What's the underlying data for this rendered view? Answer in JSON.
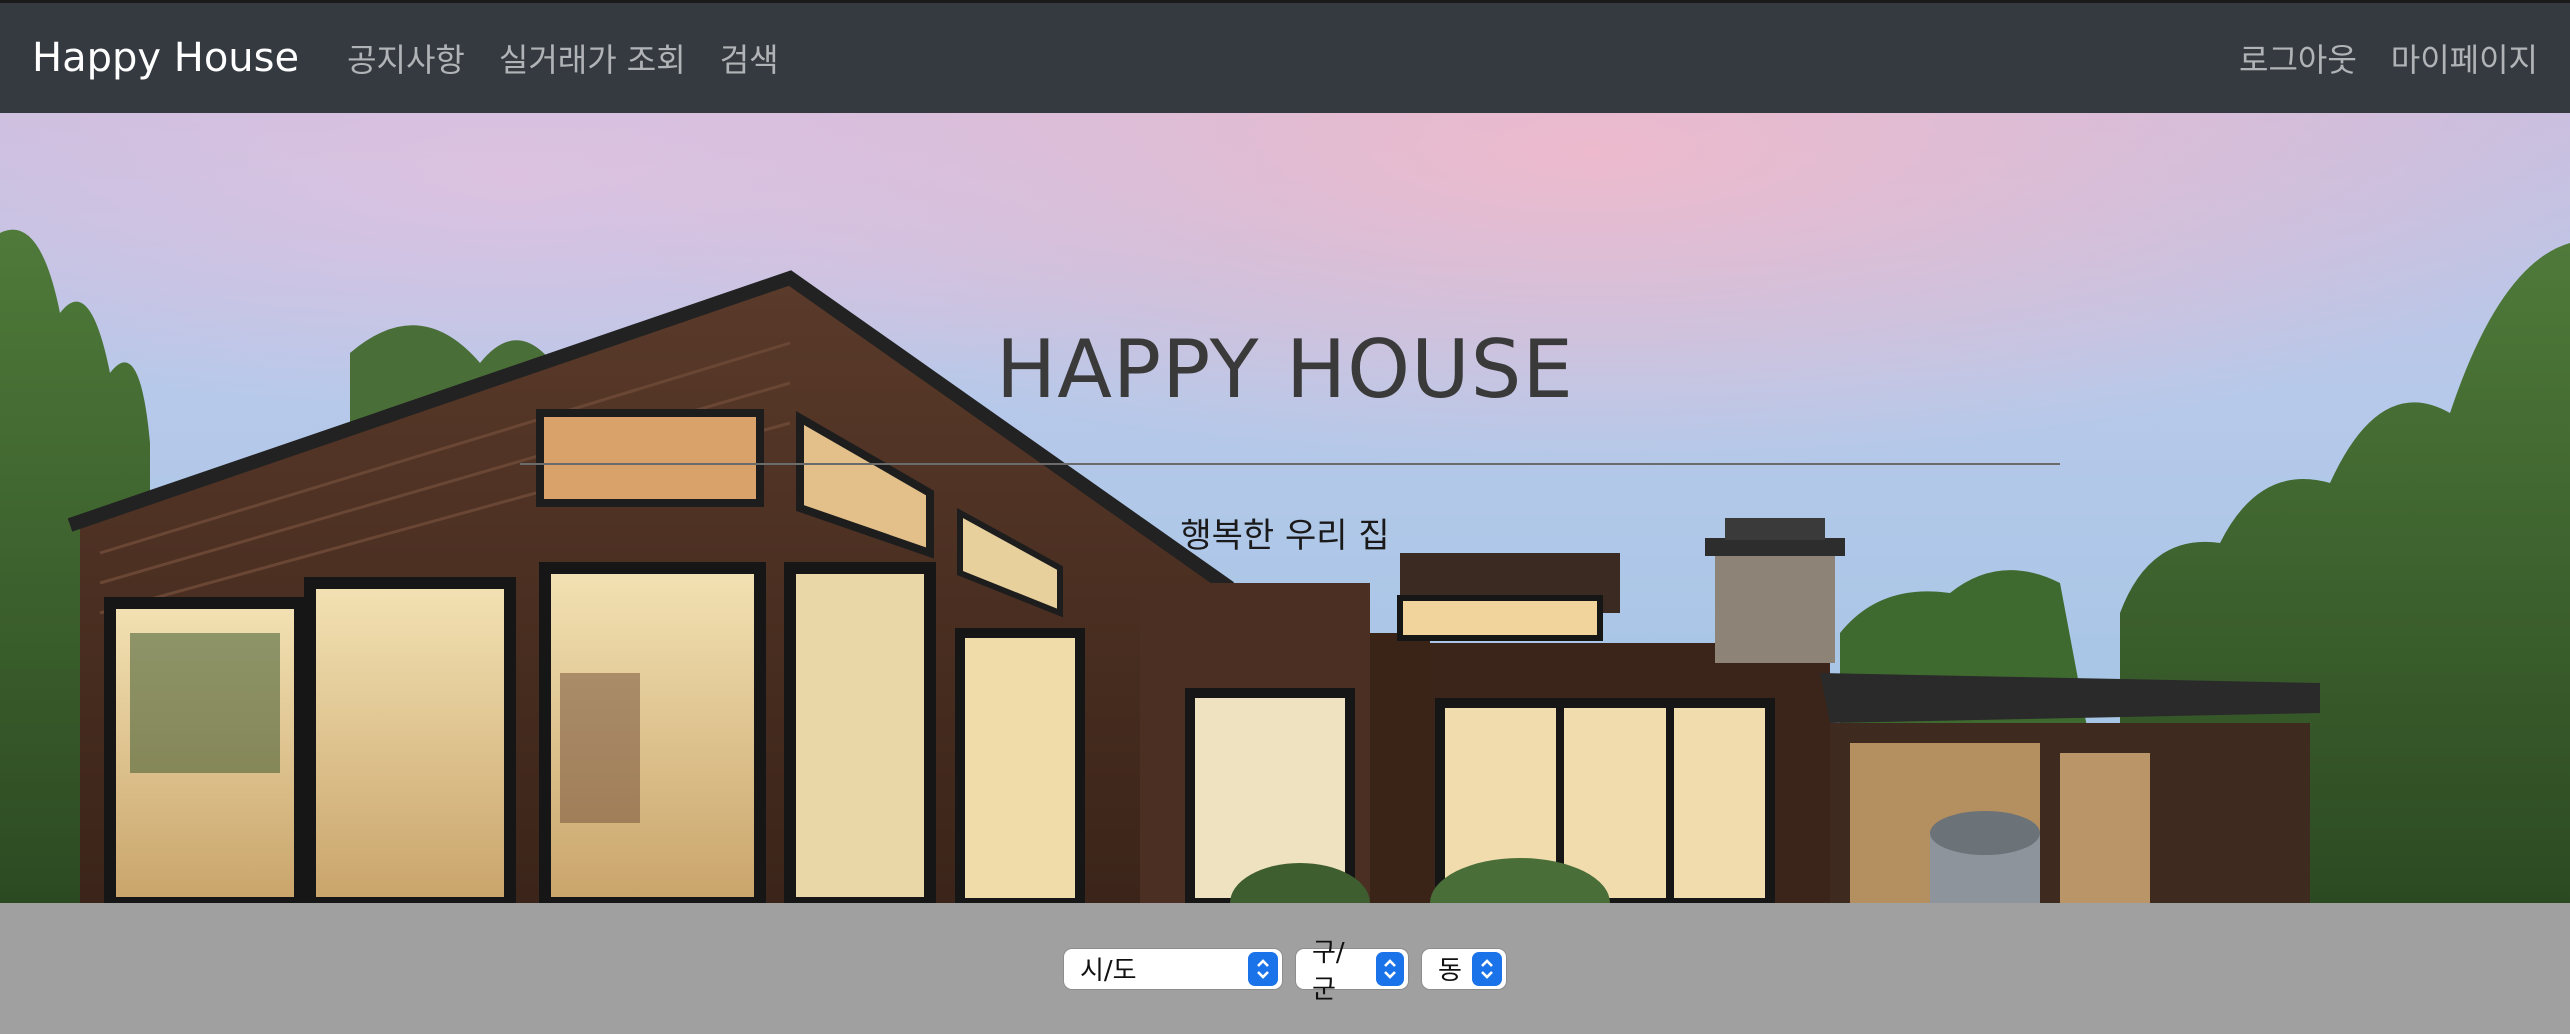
{
  "navbar": {
    "brand": "Happy House",
    "left_links": [
      "공지사항",
      "실거래가 조회",
      "검색"
    ],
    "right_links": [
      "로그아웃",
      "마이페이지"
    ]
  },
  "hero": {
    "title": "HAPPY HOUSE",
    "subtitle": "행복한 우리 집"
  },
  "filters": {
    "sido": "시/도",
    "gugun": "구/군",
    "dong": "동"
  },
  "colors": {
    "navbar_bg": "#343a40",
    "footer_bg": "#a0a0a0",
    "select_accent": "#1a73e8"
  }
}
